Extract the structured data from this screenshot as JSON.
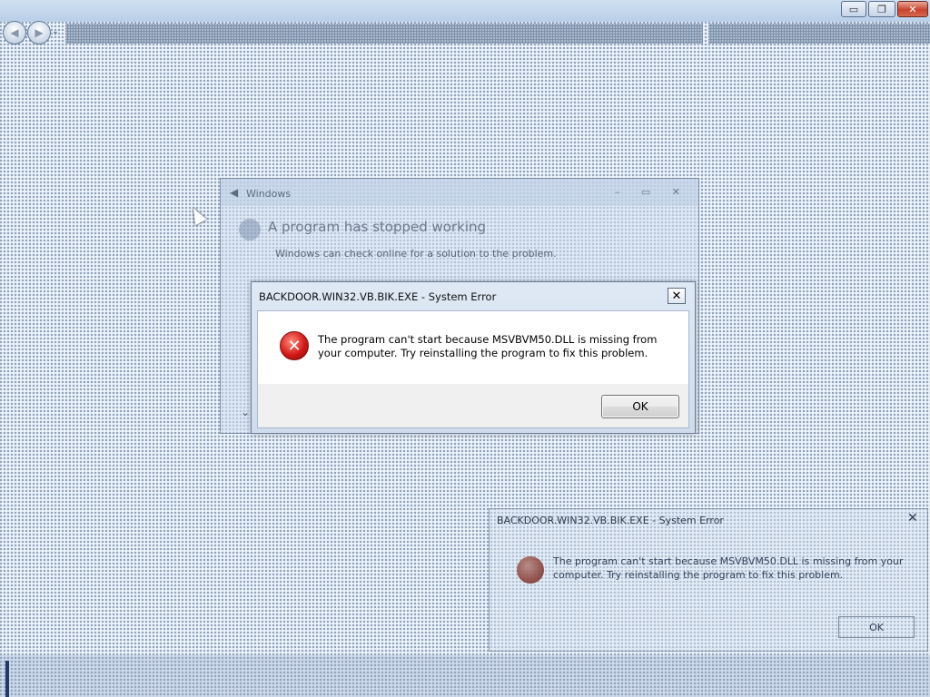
{
  "background_window": {
    "caption_buttons": {
      "minimize": "▭",
      "maximize": "❐",
      "close": "✕"
    },
    "nav": {
      "back_icon": "◀",
      "forward_icon": "▶",
      "dropdown_icon": "▾"
    }
  },
  "stopped_window": {
    "title": "Windows",
    "heading": "A program has stopped working",
    "body": "Windows can check online for a solution to the problem.",
    "back_icon": "◀",
    "controls": "– ▭ ✕",
    "chevron_icon": "⌄"
  },
  "error_dialog": {
    "title": "BACKDOOR.WIN32.VB.BIK.EXE - System Error",
    "close_icon": "✕",
    "icon": "✕",
    "message": "The program can't start because MSVBVM50.DLL is missing from your computer. Try reinstalling the program to fix this problem.",
    "ok_label": "OK"
  },
  "ghost_dialog": {
    "title": "BACKDOOR.WIN32.VB.BIK.EXE - System Error",
    "close_icon": "✕",
    "message": "The program can't start because MSVBVM50.DLL is missing from your computer. Try reinstalling the program to fix this problem.",
    "ok_label": "OK"
  },
  "colors": {
    "error_red": "#d51919",
    "titlebar_blue": "#cfdced",
    "close_red": "#c8432c"
  }
}
